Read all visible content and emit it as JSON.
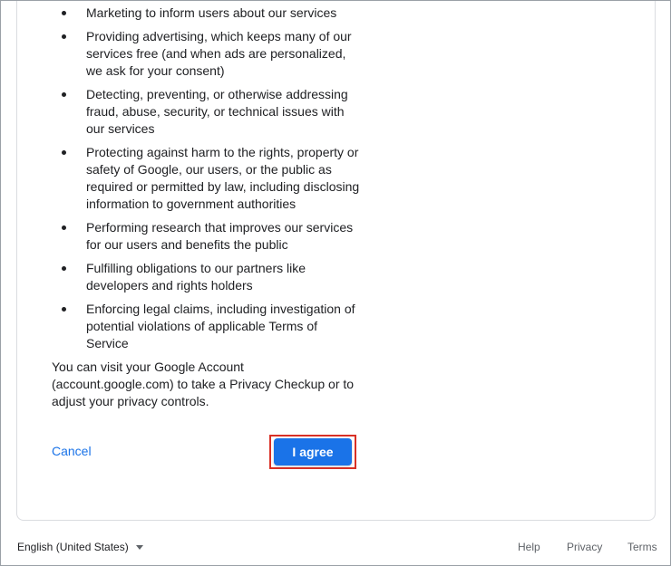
{
  "purposes": [
    "Marketing to inform users about our services",
    "Providing advertising, which keeps many of our services free (and when ads are personalized, we ask for your consent)",
    "Detecting, preventing, or otherwise addressing fraud, abuse, security, or technical issues with our services",
    "Protecting against harm to the rights, property or safety of Google, our users, or the public as required or permitted by law, including disclosing information to government authorities",
    "Performing research that improves our services for our users and benefits the public",
    "Fulfilling obligations to our partners like developers and rights holders",
    "Enforcing legal claims, including investigation of potential violations of applicable Terms of Service"
  ],
  "visit_text": "You can visit your Google Account (account.google.com) to take a Privacy Checkup or to adjust your privacy controls.",
  "actions": {
    "cancel_label": "Cancel",
    "agree_label": "I agree"
  },
  "footer": {
    "language": "English (United States)",
    "help": "Help",
    "privacy": "Privacy",
    "terms": "Terms"
  },
  "colors": {
    "accent": "#1a73e8",
    "highlight_outline": "#d93025"
  }
}
